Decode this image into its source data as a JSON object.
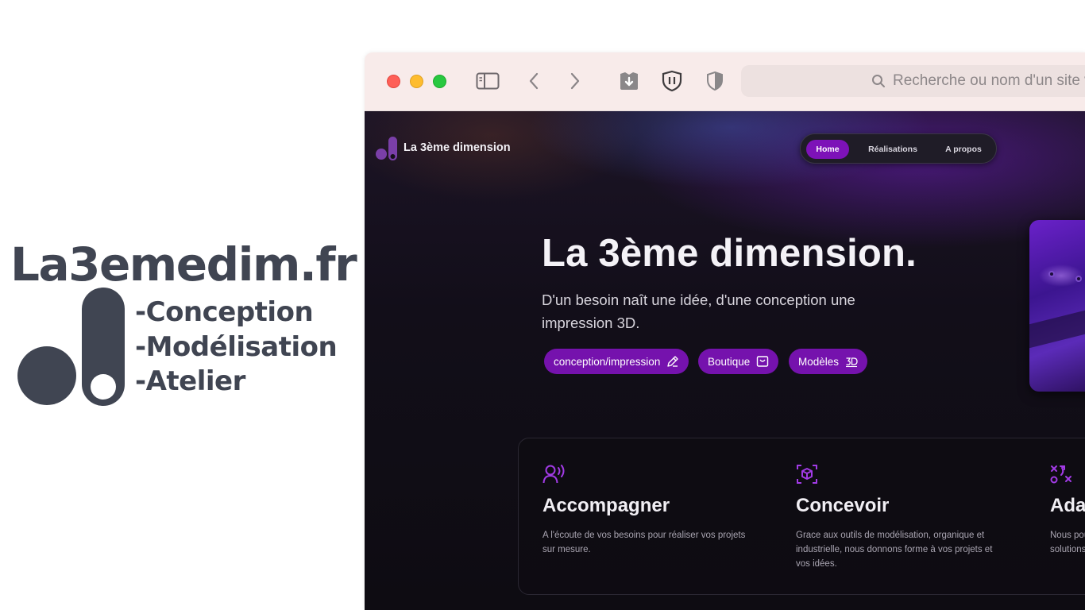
{
  "brand": {
    "domain": "La3emedim.fr",
    "features": [
      "-Conception",
      "-Modélisation",
      "-Atelier"
    ]
  },
  "browser": {
    "address_placeholder": "Recherche ou nom d'un site web"
  },
  "site": {
    "name": "La 3ème dimension",
    "nav": [
      "Home",
      "Réalisations",
      "A propos"
    ],
    "active_nav": "Home",
    "hero_title": "La 3ème dimension.",
    "hero_subtitle": "D'un besoin naît une idée, d'une conception une impression 3D.",
    "buttons": [
      {
        "label": "conception/impression",
        "icon": "pencil-icon"
      },
      {
        "label": "Boutique",
        "icon": "cart-icon"
      },
      {
        "label": "Modèles",
        "icon": "3d-icon"
      }
    ],
    "features": [
      {
        "title": "Accompagner",
        "text": "A l'écoute de vos besoins pour réaliser vos projets sur mesure.",
        "icon": "headset-voice-icon"
      },
      {
        "title": "Concevoir",
        "text": "Grace aux outils de modélisation, organique et industrielle, nous donnons forme à vos projets et vos idées.",
        "icon": "cube-scan-icon"
      },
      {
        "title": "Adapter",
        "text": "Nous pouvons vous proposer une large gamme de solutions.",
        "icon": "strategy-icon"
      }
    ]
  },
  "colors": {
    "brand_gray": "#404552",
    "accent_purple": "#7d12b8",
    "page_dark": "#0e0c12"
  }
}
